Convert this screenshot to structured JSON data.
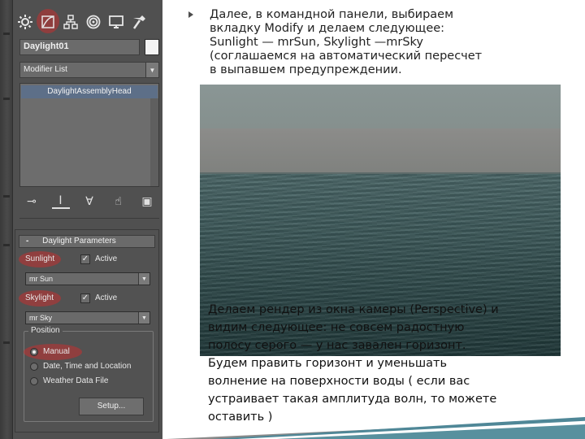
{
  "panel": {
    "tabs": [
      {
        "name": "create",
        "icon": "sun-gear-icon"
      },
      {
        "name": "modify",
        "icon": "modify-icon"
      },
      {
        "name": "hierarchy",
        "icon": "hierarchy-icon"
      },
      {
        "name": "motion",
        "icon": "motion-icon"
      },
      {
        "name": "display",
        "icon": "display-icon"
      },
      {
        "name": "utilities",
        "icon": "hammer-icon"
      }
    ],
    "active_tab": "modify",
    "object_name": "Daylight01",
    "modifier_list": "Modifier List",
    "stack_item": "DaylightAssemblyHead",
    "rollout": {
      "title": "Daylight Parameters",
      "sunlight_label": "Sunlight",
      "sunlight_active": "Active",
      "sunlight_value": "mr Sun",
      "skylight_label": "Skylight",
      "skylight_active": "Active",
      "skylight_value": "mr Sky",
      "position_title": "Position",
      "position_options": [
        "Manual",
        "Date, Time and Location",
        "Weather Data File"
      ],
      "position_selected": "Manual",
      "setup_label": "Setup..."
    },
    "highlight_color": "#dc2828"
  },
  "content": {
    "top_text": "Далее, в командной панели, выбираем\nвкладку Modify и делаем следующее:\nSunlight — mrSun, Skylight —mrSky\n(соглашаемся на автоматический пересчет\nв выпавшем предупреждении.",
    "bottom_text": "Делаем рендер из  окна камеры (Perspective) и\nвидим следующее: не совсем радостную\nполосу серого — у нас завален горизонт.\nБудем править  горизонт и уменьшать\nволнение на поверхности воды ( если вас\nустраивает такая амплитуда волн, то  можете\nоставить  )"
  }
}
